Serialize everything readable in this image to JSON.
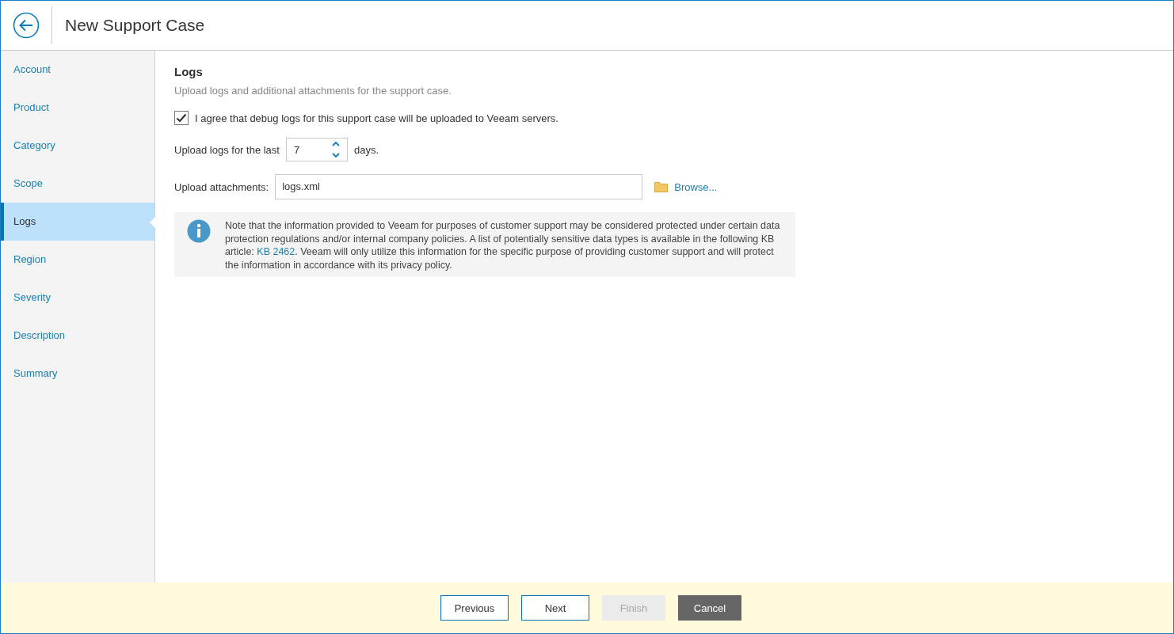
{
  "window": {
    "title": "New Support Case"
  },
  "sidebar": {
    "items": [
      {
        "label": "Account",
        "selected": false
      },
      {
        "label": "Product",
        "selected": false
      },
      {
        "label": "Category",
        "selected": false
      },
      {
        "label": "Scope",
        "selected": false
      },
      {
        "label": "Logs",
        "selected": true
      },
      {
        "label": "Region",
        "selected": false
      },
      {
        "label": "Severity",
        "selected": false
      },
      {
        "label": "Description",
        "selected": false
      },
      {
        "label": "Summary",
        "selected": false
      }
    ]
  },
  "section": {
    "title": "Logs",
    "subtitle": "Upload logs and additional attachments for the support case."
  },
  "agree": {
    "label": "I agree that debug logs for this support case will be uploaded to Veeam servers.",
    "checked": true
  },
  "days": {
    "label": "Upload logs for the last",
    "value": "7",
    "suffix": "days."
  },
  "attachments": {
    "label": "Upload attachments:",
    "value": "logs.xml",
    "browse": "Browse..."
  },
  "note": {
    "before": "Note that the information provided to Veeam for purposes of customer support may be considered protected under certain data protection regulations and/or internal company policies. A list of potentially sensitive data types is available in the following KB article: ",
    "link": "KB 2462",
    "after": ". Veeam will only utilize this information for the specific purpose of providing customer support and will protect the information in accordance with its privacy policy."
  },
  "buttons": [
    {
      "label": "Previous",
      "kind": "outline",
      "disabled": false
    },
    {
      "label": "Next",
      "kind": "outline",
      "disabled": false
    },
    {
      "label": "Finish",
      "kind": "outline",
      "disabled": true
    },
    {
      "label": "Cancel",
      "kind": "dark",
      "disabled": false
    }
  ]
}
